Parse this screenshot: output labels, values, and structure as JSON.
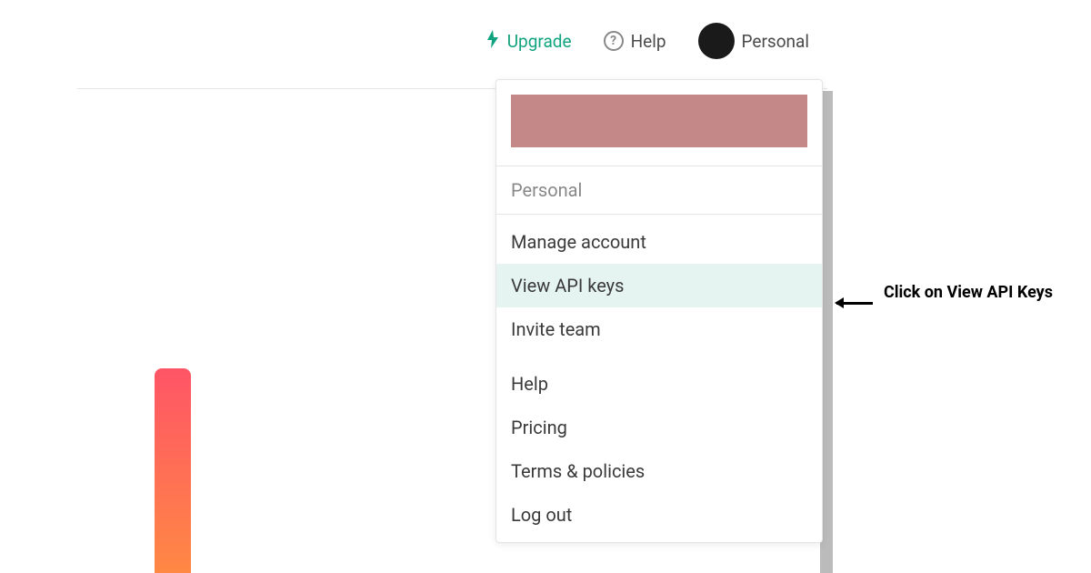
{
  "nav": {
    "upgrade": "Upgrade",
    "help": "Help",
    "personal": "Personal"
  },
  "dropdown": {
    "label": "Personal",
    "section1": {
      "manage_account": "Manage account",
      "view_api_keys": "View API keys",
      "invite_team": "Invite team"
    },
    "section2": {
      "help": "Help",
      "pricing": "Pricing",
      "terms": "Terms & policies",
      "logout": "Log out"
    }
  },
  "annotation": {
    "text": "Click on View API Keys"
  }
}
